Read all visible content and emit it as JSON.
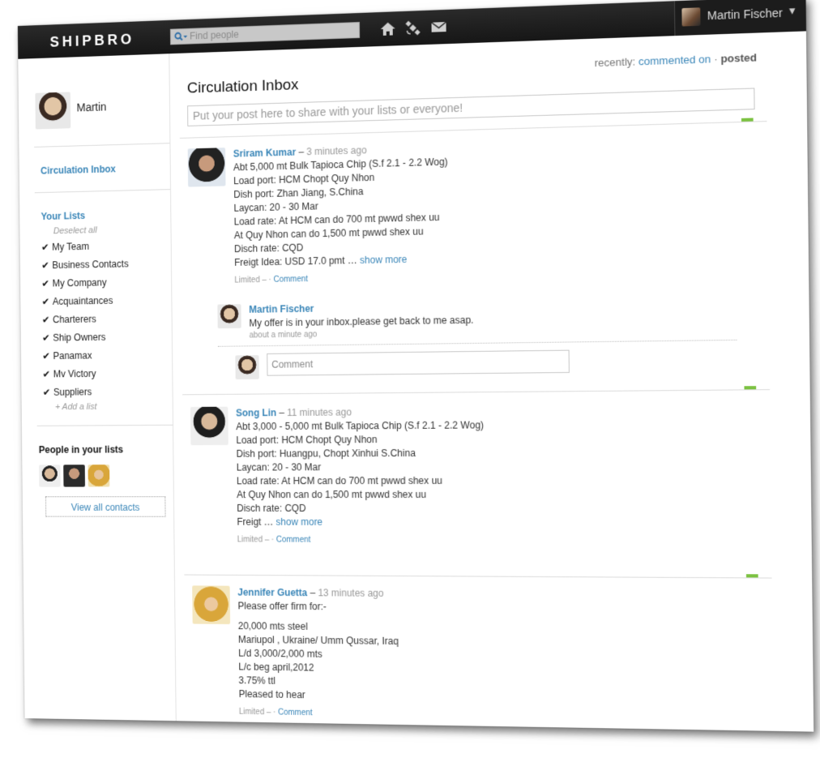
{
  "topbar": {
    "logo": "SHIPBRO",
    "search_placeholder": "Find people",
    "nav_icons": [
      "home-icon",
      "satellite-icon",
      "mail-icon"
    ],
    "user_name": "Martin Fischer",
    "caret": "▼"
  },
  "sidebar": {
    "me_name": "Martin",
    "circulation_inbox": "Circulation Inbox",
    "your_lists": "Your Lists",
    "deselect_all": "Deselect all",
    "lists": [
      {
        "label": "My Team",
        "checked": true
      },
      {
        "label": "Business Contacts",
        "checked": true
      },
      {
        "label": "My Company",
        "checked": true
      },
      {
        "label": "Acquaintances",
        "checked": true
      },
      {
        "label": "Charterers",
        "checked": true
      },
      {
        "label": "Ship Owners",
        "checked": true
      },
      {
        "label": "Panamax",
        "checked": true
      },
      {
        "label": "Mv Victory",
        "checked": true
      },
      {
        "label": "Suppliers",
        "checked": true
      }
    ],
    "add_list": "+ Add a list",
    "people_title": "People in your lists",
    "view_all": "View all contacts",
    "check_glyph": "✔"
  },
  "main": {
    "recently_label": "recently:",
    "recently_link": "commented on",
    "recently_sep": "·",
    "recently_current": "posted",
    "title": "Circulation Inbox",
    "share_placeholder": "Put your post here to share with your lists or everyone!",
    "posts": [
      {
        "author": "Sriram Kumar",
        "dash": "–",
        "ago": "3 minutes ago",
        "lines": [
          "Abt 5,000 mt Bulk Tapioca Chip (S.f 2.1 - 2.2 Wog)",
          "Load port: HCM Chopt Quy Nhon",
          "Dish port: Zhan Jiang, S.China",
          "Laycan: 20 - 30 Mar",
          "Load rate: At HCM can do 700 mt pwwd shex uu",
          "At Quy Nhon can do 1,500 mt pwwd shex uu",
          "Disch rate: CQD",
          "Freigt Idea: USD 17.0 pmt …"
        ],
        "show_more": "show more",
        "meta_prefix": "Limited – ·",
        "comment_link": "Comment",
        "reply": {
          "name": "Martin Fischer",
          "text": "My offer is in your inbox.please get back to me asap.",
          "ago": "about a minute ago"
        },
        "comment_placeholder": "Comment"
      },
      {
        "author": "Song Lin",
        "dash": "–",
        "ago": "11 minutes ago",
        "lines": [
          "Abt 3,000 - 5,000 mt Bulk Tapioca Chip (S.f 2.1 - 2.2 Wog)",
          "Load port: HCM Chopt Quy Nhon",
          "Dish port: Huangpu, Chopt Xinhui S.China",
          "Laycan: 20 - 30 Mar",
          "Load rate: At HCM can do 700 mt pwwd shex uu",
          "At Quy Nhon can do 1,500 mt pwwd shex uu",
          "Disch rate: CQD",
          "Freigt …"
        ],
        "show_more": "show more",
        "meta_prefix": "Limited – ·",
        "comment_link": "Comment"
      },
      {
        "author": "Jennifer Guetta",
        "dash": "–",
        "ago": "13 minutes ago",
        "lines": [
          "Please offer firm for:-",
          "",
          "20,000 mts steel",
          "Mariupol , Ukraine/ Umm Qussar, Iraq",
          "L/d 3,000/2,000 mts",
          "L/c beg april,2012",
          "3.75% ttl",
          "Pleased to hear"
        ],
        "meta_prefix": "Limited – ·",
        "comment_link": "Comment"
      }
    ]
  },
  "colors": {
    "link": "#3a86b8",
    "topbar": "#1c1c1c",
    "accent_green": "#7cc242"
  }
}
